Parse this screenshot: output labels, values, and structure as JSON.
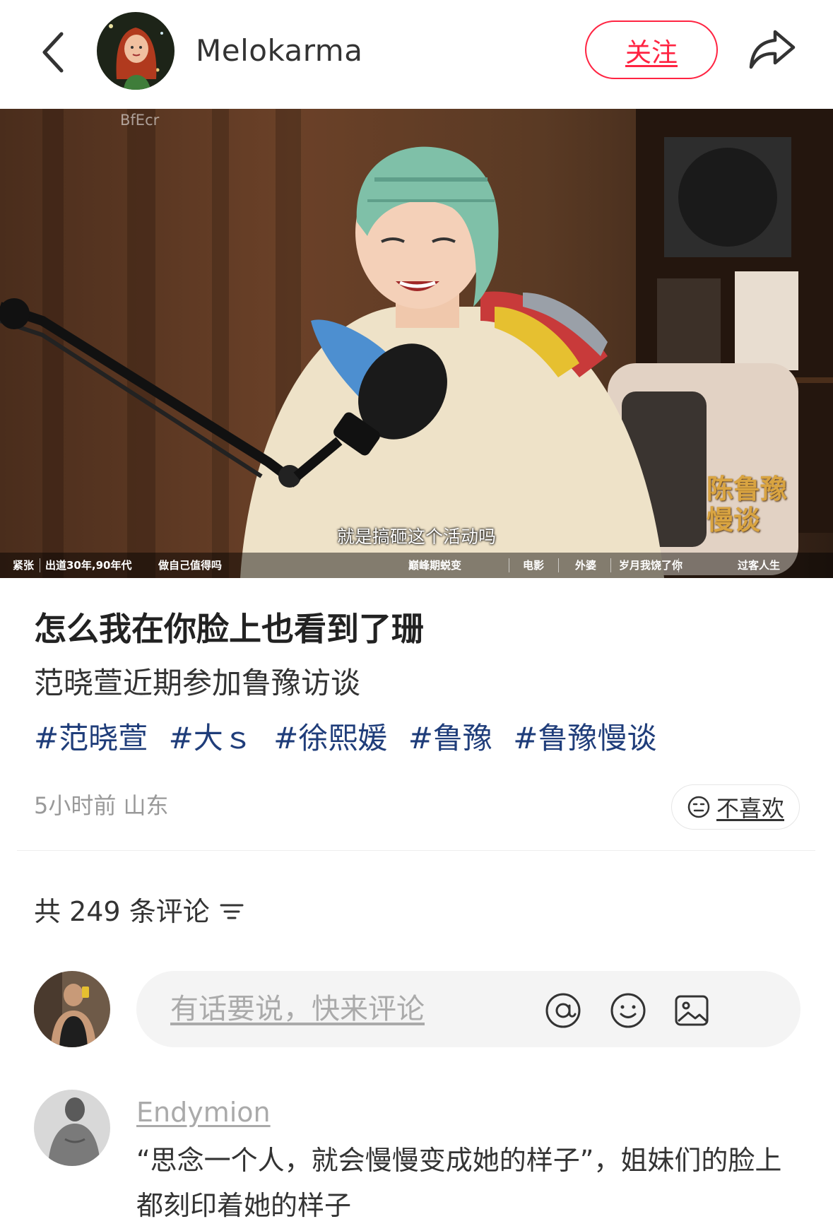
{
  "header": {
    "author_name": "Melokarma",
    "follow_label": "关注"
  },
  "video": {
    "subtitle": "就是搞砸这个活动吗",
    "watermark": [
      "陈鲁豫",
      "慢谈"
    ],
    "overlay_text": "BfEcr",
    "chapters": [
      "紧张",
      "出道30年,90年代",
      "做自己值得吗",
      "巅峰期蜕变",
      "电影",
      "外婆",
      "岁月我饶了你",
      "过客人生"
    ]
  },
  "post": {
    "title": "怎么我在你脸上也看到了珊",
    "description": "范晓萱近期参加鲁豫访谈",
    "tags": [
      "#范晓萱",
      "#大ｓ",
      "#徐熙媛",
      "#鲁豫",
      "#鲁豫慢谈"
    ],
    "meta": "5小时前 山东",
    "dislike_label": "不喜欢"
  },
  "comments": {
    "count_label": "共 249 条评论",
    "input_placeholder": "有话要说，快来评论",
    "items": [
      {
        "user": "Endymion",
        "text": "“思念一个人，就会慢慢变成她的样子”，姐妹们的脸上都刻印着她的样子"
      }
    ]
  },
  "colors": {
    "brand": "#ff2442",
    "tag": "#1f3d7a",
    "muted": "#999999"
  }
}
